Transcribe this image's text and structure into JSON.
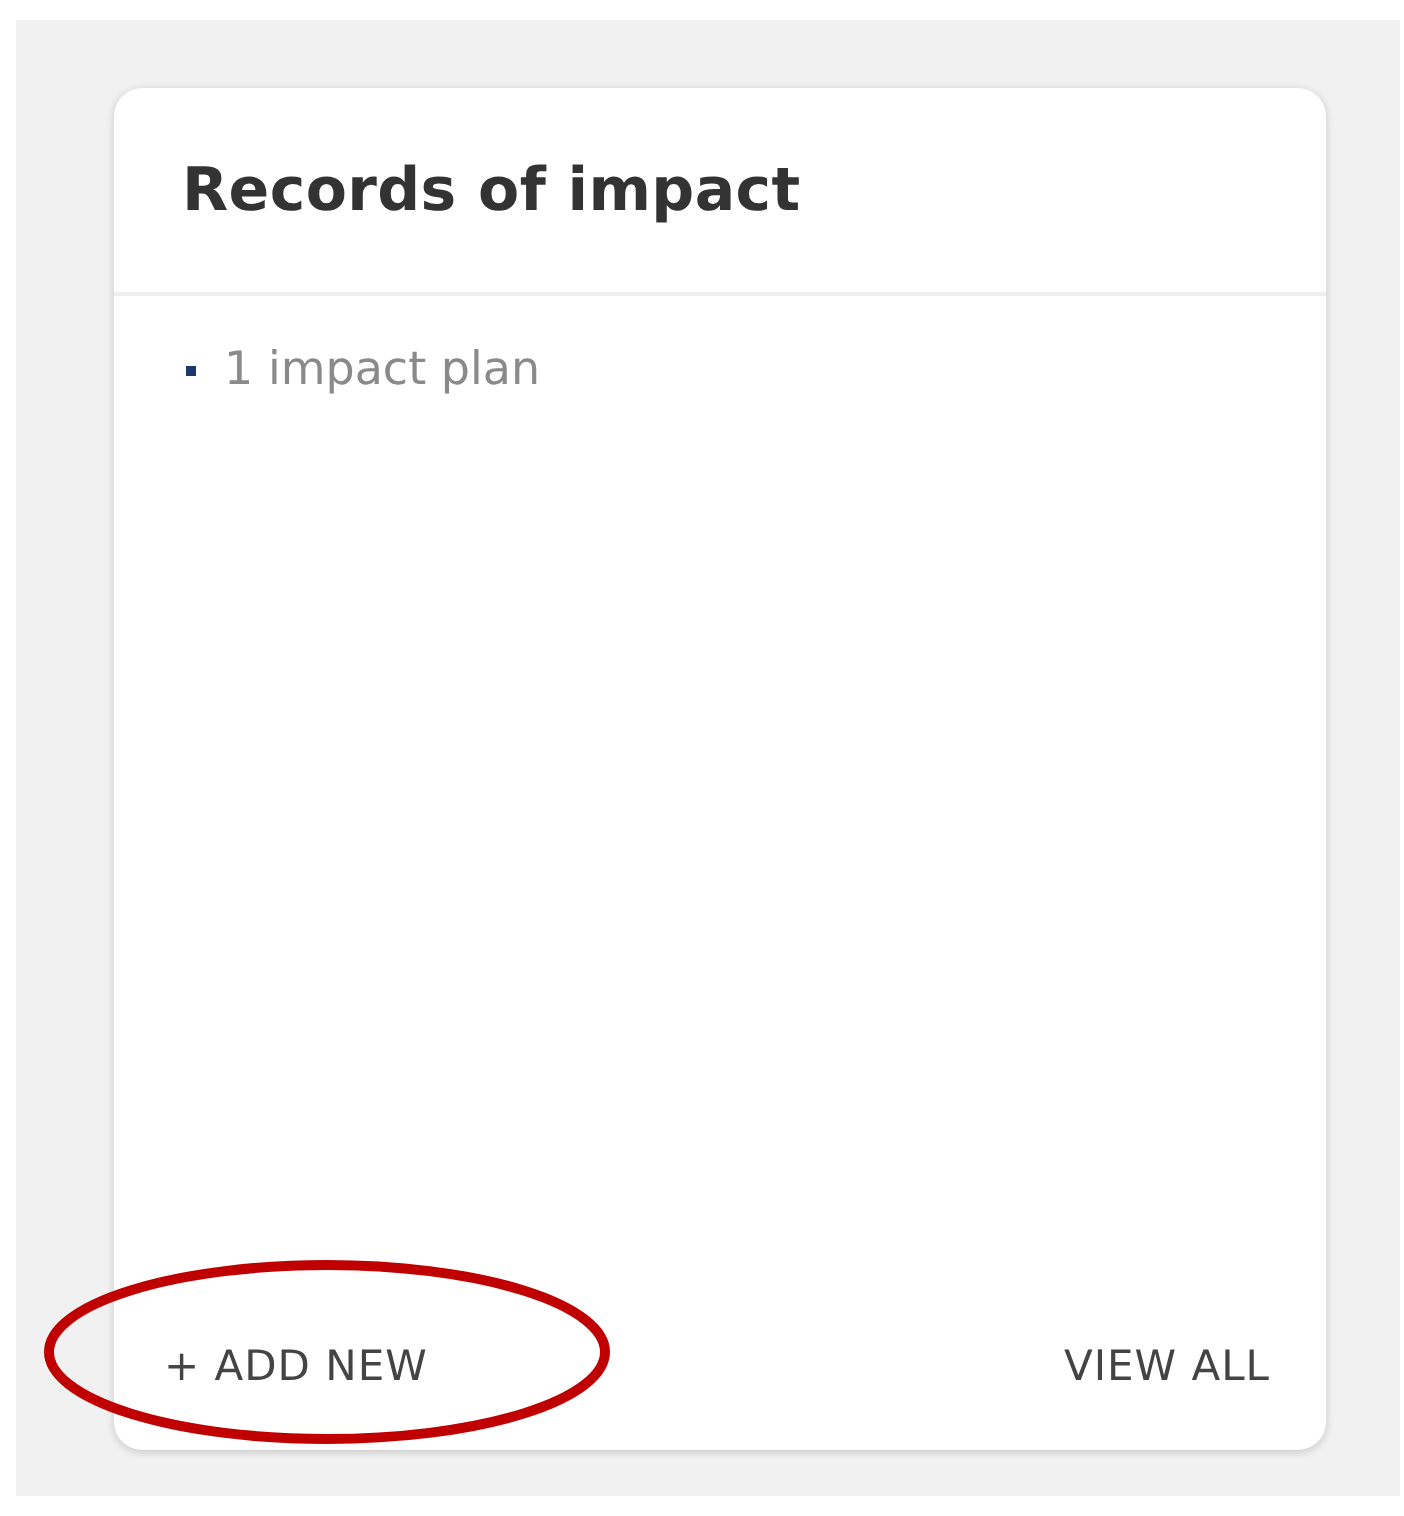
{
  "card": {
    "title": "Records of impact",
    "items": [
      "1 impact plan"
    ],
    "actions": [
      {
        "label": "+ ADD NEW"
      },
      {
        "label": "VIEW ALL"
      }
    ]
  },
  "annotation": {
    "kind": "ellipse"
  }
}
